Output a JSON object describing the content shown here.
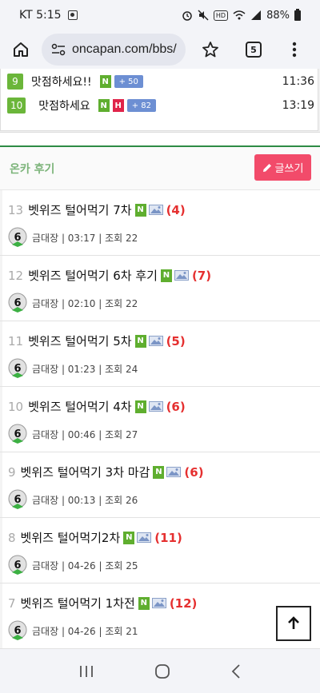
{
  "status_bar": {
    "carrier_time": "KT 5:15",
    "hd_label": "HD",
    "battery": "88%"
  },
  "browser": {
    "url": "oncapan.com/bbs/",
    "tab_count": "5"
  },
  "ranking": [
    {
      "rank": "9",
      "title": "맛점하세요!!",
      "badges": [
        "N"
      ],
      "plus": "+ 50",
      "time": "11:36"
    },
    {
      "rank": "10",
      "title": "맛점하세요",
      "badges": [
        "N",
        "H"
      ],
      "plus": "+ 82",
      "time": "13:19"
    }
  ],
  "section": {
    "title": "온카 후기",
    "write_button": "글쓰기"
  },
  "posts": [
    {
      "num": "13",
      "title": "벳위즈 털어먹기 7차",
      "new": "N",
      "comments": "(4)",
      "author": "금대장",
      "time": "03:17",
      "views_label": "조회",
      "views": "22"
    },
    {
      "num": "12",
      "title": "벳위즈 털어먹기 6차 후기",
      "new": "N",
      "comments": "(7)",
      "author": "금대장",
      "time": "02:10",
      "views_label": "조회",
      "views": "22"
    },
    {
      "num": "11",
      "title": "벳위즈 털어먹기 5차",
      "new": "N",
      "comments": "(5)",
      "author": "금대장",
      "time": "01:23",
      "views_label": "조회",
      "views": "24"
    },
    {
      "num": "10",
      "title": "벳위즈 털어먹기 4차",
      "new": "N",
      "comments": "(6)",
      "author": "금대장",
      "time": "00:46",
      "views_label": "조회",
      "views": "27"
    },
    {
      "num": "9",
      "title": "벳위즈 털어먹기 3차 마감",
      "new": "N",
      "comments": "(6)",
      "author": "금대장",
      "time": "00:13",
      "views_label": "조회",
      "views": "26"
    },
    {
      "num": "8",
      "title": "벳위즈 털어먹기2차",
      "new": "N",
      "comments": "(11)",
      "author": "금대장",
      "time": "04-26",
      "views_label": "조회",
      "views": "25"
    },
    {
      "num": "7",
      "title": "벳위즈 털어먹기 1차전",
      "new": "N",
      "comments": "(12)",
      "author": "금대장",
      "time": "04-26",
      "views_label": "조회",
      "views": "21"
    }
  ],
  "avatar_level": "6",
  "colors": {
    "rank_green": "#6bb63a",
    "badge_new": "#5fae2f",
    "badge_hot": "#e0244a",
    "badge_plus": "#6d8fd3",
    "section_title": "#7cb47a",
    "write_button": "#f24b6a",
    "comments": "#e53030",
    "divider_green": "#2e8b44"
  },
  "icons": {
    "home": "home-icon",
    "site_info": "tune-icon",
    "star": "star-outline-icon",
    "menu": "more-vert-icon",
    "pencil": "pencil-icon",
    "image": "image-icon",
    "scroll_top": "arrow-up-icon",
    "nav_recents": "recents-icon",
    "nav_home": "home-circle-icon",
    "nav_back": "back-chevron-icon"
  }
}
